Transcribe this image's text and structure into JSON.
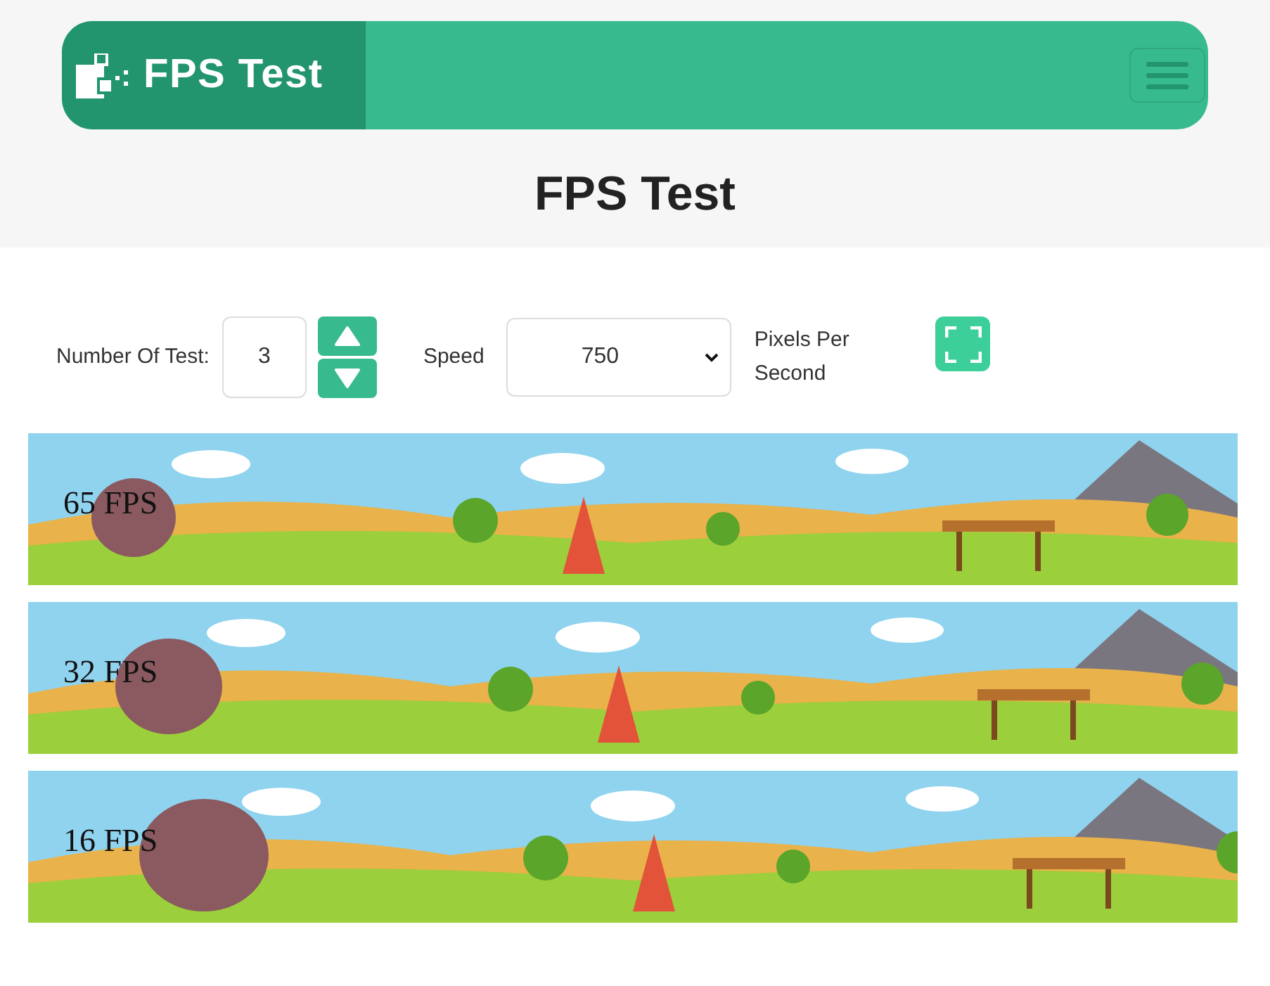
{
  "header": {
    "logo_text": "FPS Test"
  },
  "page_title": "FPS Test",
  "controls": {
    "number_label": "Number Of Test:",
    "number_value": "3",
    "speed_label": "Speed",
    "speed_value": "750",
    "unit_label": "Pixels Per Second"
  },
  "tests": [
    {
      "fps_label": "65 FPS"
    },
    {
      "fps_label": "32 FPS"
    },
    {
      "fps_label": "16 FPS"
    }
  ]
}
